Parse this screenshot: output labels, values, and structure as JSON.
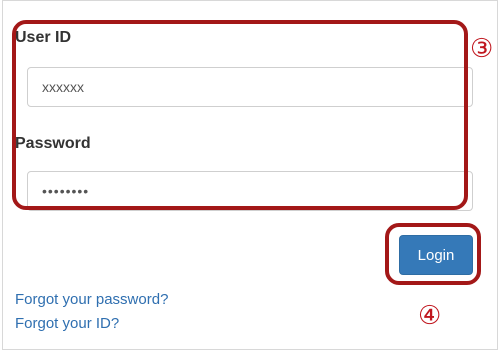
{
  "form": {
    "user_id_label": "User ID",
    "user_id_value": "xxxxxx",
    "password_label": "Password",
    "password_value": "••••••••",
    "login_label": "Login"
  },
  "links": {
    "forgot_password": "Forgot your password?",
    "forgot_id": "Forgot your ID?"
  },
  "callouts": {
    "credentials_marker": "③",
    "login_marker": "④"
  },
  "colors": {
    "callout_border": "#a31818",
    "marker_text": "#c0161e",
    "login_button": "#3579b8",
    "link": "#2f6fb0"
  }
}
